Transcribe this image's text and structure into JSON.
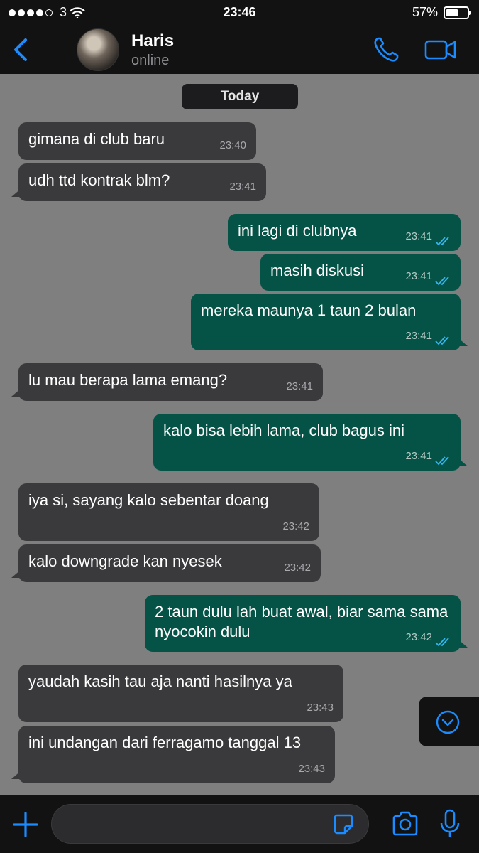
{
  "status_bar": {
    "carrier": "3",
    "time": "23:46",
    "battery": "57%",
    "battery_level": 0.57
  },
  "header": {
    "contact_name": "Haris",
    "contact_status": "online"
  },
  "chat": {
    "date_label": "Today",
    "messages": [
      {
        "dir": "in",
        "text": "gimana di club baru",
        "time": "23:40"
      },
      {
        "dir": "in",
        "text": "udh ttd kontrak blm?",
        "time": "23:41"
      },
      {
        "dir": "out",
        "text": "ini lagi di clubnya",
        "time": "23:41",
        "status": "read"
      },
      {
        "dir": "out",
        "text": "masih diskusi",
        "time": "23:41",
        "status": "read"
      },
      {
        "dir": "out",
        "text": "mereka maunya 1 taun 2 bulan",
        "time": "23:41",
        "status": "read"
      },
      {
        "dir": "in",
        "text": "lu mau berapa lama emang?",
        "time": "23:41"
      },
      {
        "dir": "out",
        "text": "kalo bisa lebih lama, club bagus ini",
        "time": "23:41",
        "status": "read"
      },
      {
        "dir": "in",
        "text": "iya si, sayang kalo sebentar doang",
        "time": "23:42"
      },
      {
        "dir": "in",
        "text": "kalo downgrade kan nyesek",
        "time": "23:42"
      },
      {
        "dir": "out",
        "text": "2 taun dulu lah buat awal, biar sama sama nyocokin dulu",
        "time": "23:42",
        "status": "read"
      },
      {
        "dir": "in",
        "text": "yaudah kasih tau aja nanti hasilnya ya",
        "time": "23:43"
      },
      {
        "dir": "in",
        "text": "ini undangan dari ferragamo tanggal 13",
        "time": "23:43"
      }
    ]
  },
  "input": {
    "placeholder": ""
  },
  "colors": {
    "accent": "#1a8cff",
    "incoming_bubble": "#3a3a3c",
    "outgoing_bubble": "#055346",
    "read_ticks": "#34b7f1"
  },
  "icons": [
    "back-chevron-icon",
    "phone-icon",
    "video-camera-icon",
    "chevron-down-circle-icon",
    "plus-icon",
    "sticker-icon",
    "camera-icon",
    "microphone-icon",
    "wifi-icon",
    "battery-icon",
    "double-check-icon"
  ]
}
